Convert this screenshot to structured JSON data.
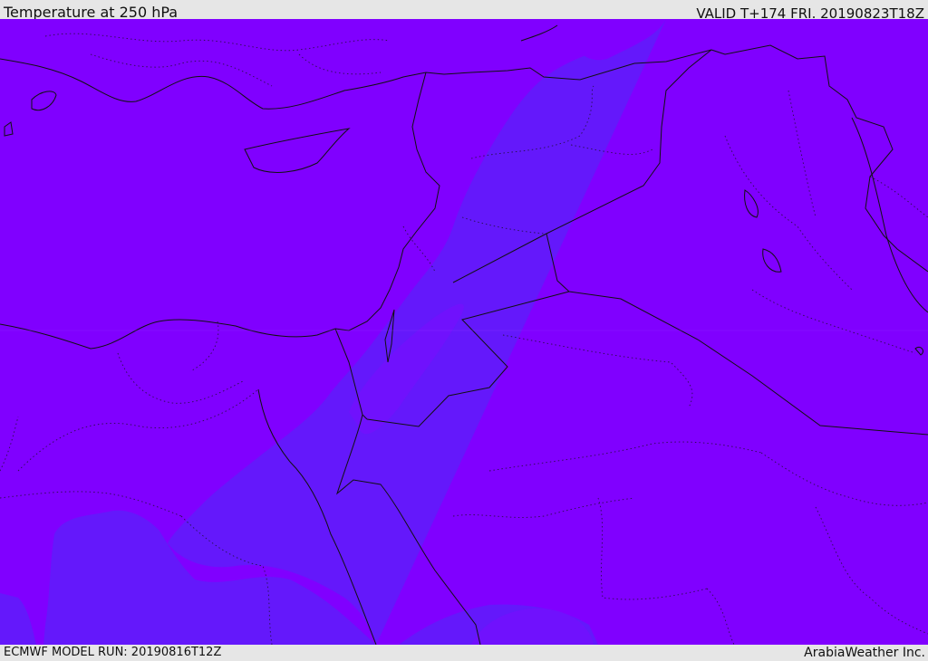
{
  "header": {
    "title": "Temperature at 250 hPa",
    "valid_time": "VALID T+174 FRI. 20190823T18Z"
  },
  "footer": {
    "model_run": "ECMWF MODEL RUN: 20190816T12Z",
    "credit": "ArabiaWeather Inc."
  },
  "colors": {
    "warm_field": "#8000ff",
    "cool_field": "#6418fb",
    "mid_field": "#7210fd",
    "coastline": "#111111",
    "background": "#e6e6e6"
  }
}
